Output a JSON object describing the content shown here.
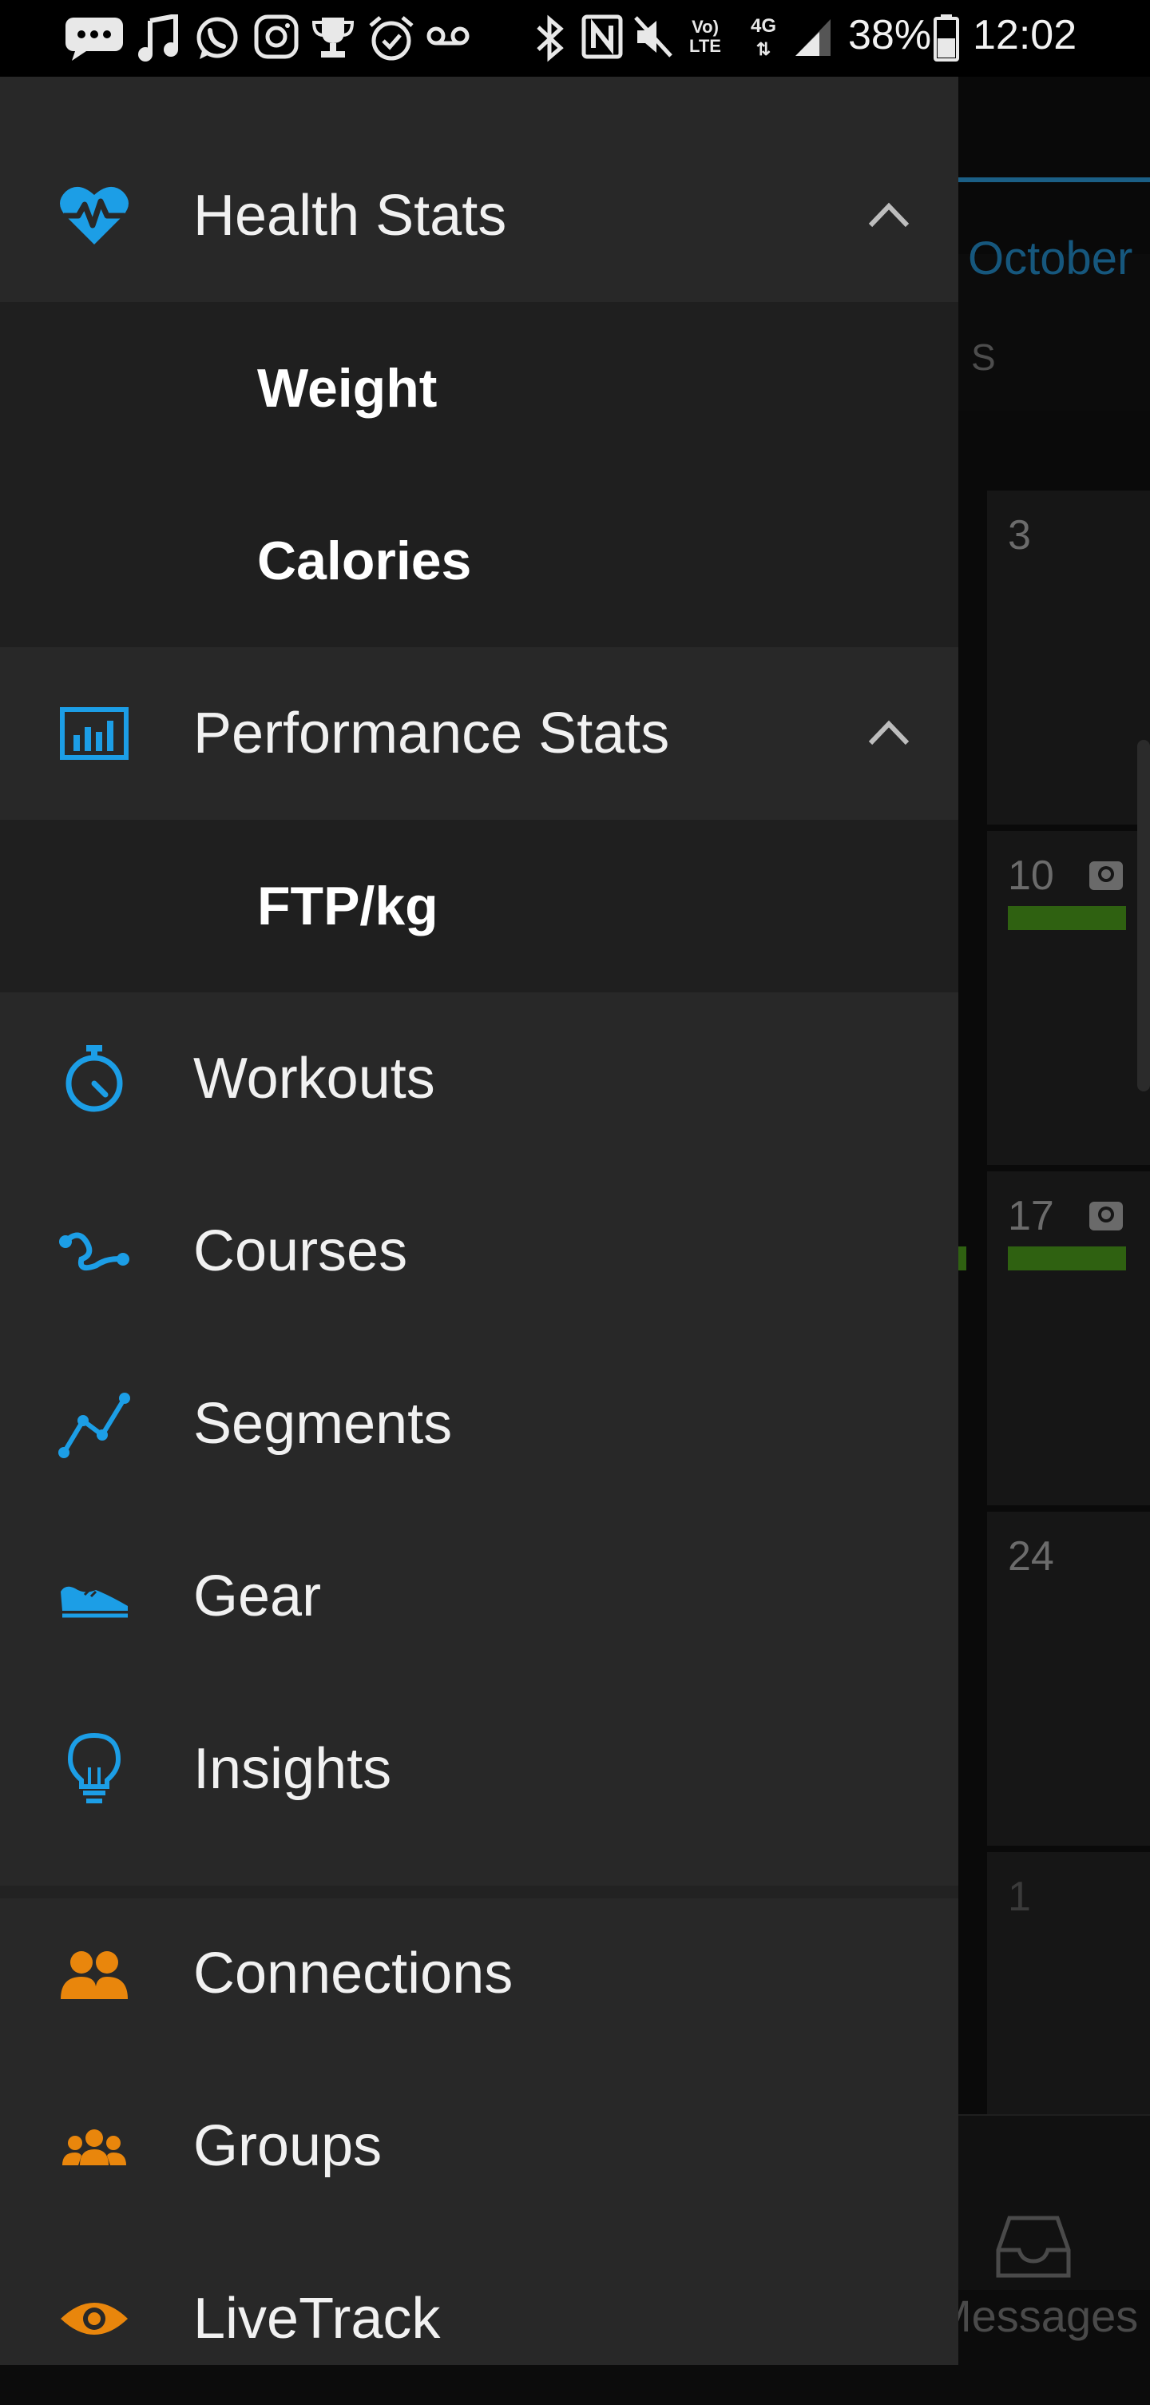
{
  "status_bar": {
    "battery_percent": "38%",
    "time": "12:02",
    "network": "4G",
    "icons": [
      "message-icon",
      "music-icon",
      "whatsapp-icon",
      "instagram-icon",
      "trophy-icon",
      "alarm-icon",
      "voicemail-icon",
      "bluetooth-icon",
      "nfc-icon",
      "mute-icon",
      "volte-icon",
      "4g-icon",
      "signal-icon",
      "battery-icon"
    ]
  },
  "drawer": {
    "sections": [
      {
        "id": "health-stats",
        "label": "Health Stats",
        "icon": "heart-pulse-icon",
        "expanded": true,
        "children": [
          {
            "label": "Weight"
          },
          {
            "label": "Calories"
          }
        ]
      },
      {
        "id": "performance-stats",
        "label": "Performance Stats",
        "icon": "bar-chart-icon",
        "expanded": true,
        "children": [
          {
            "label": "FTP/kg"
          }
        ]
      },
      {
        "id": "workouts",
        "label": "Workouts",
        "icon": "stopwatch-icon"
      },
      {
        "id": "courses",
        "label": "Courses",
        "icon": "course-route-icon"
      },
      {
        "id": "segments",
        "label": "Segments",
        "icon": "segments-icon"
      },
      {
        "id": "gear",
        "label": "Gear",
        "icon": "shoe-icon"
      },
      {
        "id": "insights",
        "label": "Insights",
        "icon": "lightbulb-icon"
      },
      {
        "id": "connections",
        "label": "Connections",
        "icon": "connections-icon"
      },
      {
        "id": "groups",
        "label": "Groups",
        "icon": "groups-icon"
      },
      {
        "id": "livetrack",
        "label": "LiveTrack",
        "icon": "eye-icon"
      }
    ]
  },
  "background": {
    "month_label": "October",
    "weekday_label": "S",
    "days": [
      "3",
      "10",
      "17",
      "24",
      "1"
    ],
    "bottom_nav": {
      "messages_label": "Messages"
    }
  },
  "colors": {
    "accent_blue": "#1c9ee6",
    "accent_orange": "#e9860c",
    "drawer_bg": "#282828",
    "subitem_bg": "#1f1f1f",
    "activity_bar": "#2f6111"
  }
}
